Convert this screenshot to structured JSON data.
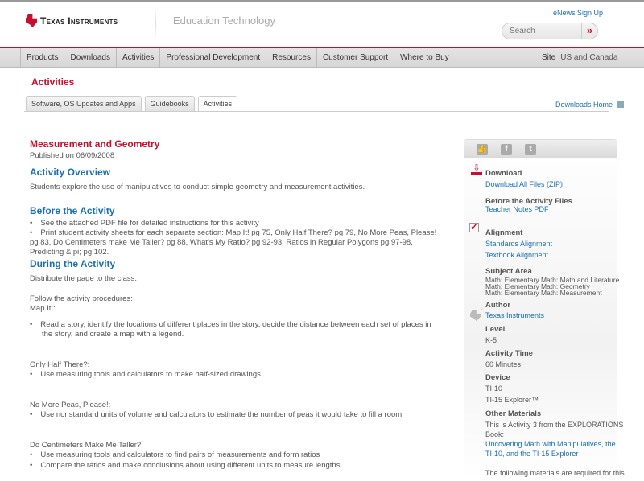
{
  "header": {
    "brand": "Texas Instruments",
    "section": "Education Technology",
    "enews": "eNews Sign Up",
    "search_placeholder": "Search",
    "search_go": "»"
  },
  "nav": {
    "items": [
      "Products",
      "Downloads",
      "Activities",
      "Professional Development",
      "Resources",
      "Customer Support",
      "Where to Buy"
    ],
    "site_label": "Site",
    "site_value": "US and Canada"
  },
  "page": {
    "title": "Activities",
    "tabs": [
      "Software, OS Updates and Apps",
      "Guidebooks",
      "Activities"
    ],
    "downloads_home": "Downloads Home"
  },
  "main": {
    "title": "Measurement and Geometry",
    "published": "Published on 06/09/2008",
    "overview_h": "Activity Overview",
    "overview": "Students explore the use of manipulatives to conduct simple geometry and measurement activities.",
    "before_h": "Before the Activity",
    "before_b1": "See the attached PDF file for detailed instructions for this activity",
    "before_b2a": "Print student activity sheets for each separate section: Map It! pg 75, Only Half There? pg 79, No More Peas, Please!",
    "before_b2b": "pg 83, Do Centimeters make Me Taller? pg 88, What's My Ratio? pg 92-93, Ratios in Regular Polygons pg 97-98,",
    "before_b2c": "Predicting & pi; pg 102.",
    "during_h": "During the Activity",
    "distribute": "Distribute the page to the class.",
    "follow": "Follow the activity procedures:",
    "mapit": "Map It!:",
    "mapit_b1a": "Read a story, identify the locations of different places in the story, decide the distance between each set of places in",
    "mapit_b1b": "the story, and create a map with a legend.",
    "half": "Only Half There?:",
    "half_b1": "Use measuring tools and calculators to make half-sized drawings",
    "peas": "No More Peas, Please!:",
    "peas_b1": "Use nonstandard units of volume and calculators to estimate the number of peas it would take to fill a room",
    "cm": "Do Centimeters Make Me Taller?:",
    "cm_b1": "Use measuring tools and calculators to find pairs of measurements and form ratios",
    "cm_b2": "Compare the ratios and make conclusions about using different units to measure lengths"
  },
  "sidebar": {
    "download_h": "Download",
    "download_all": "Download All Files (ZIP)",
    "before_files_h": "Before the Activity Files",
    "teacher_notes": "Teacher Notes PDF",
    "alignment_h": "Alignment",
    "standards": "Standards Alignment",
    "textbook": "Textbook Alignment",
    "subject_h": "Subject Area",
    "subjects": [
      "Math: Elementary Math: Math and Literature",
      "Math: Elementary Math: Geometry",
      "Math: Elementary Math: Measurement"
    ],
    "author_h": "Author",
    "author": "Texas Instruments",
    "level_h": "Level",
    "level": "K-5",
    "time_h": "Activity Time",
    "time": "60 Minutes",
    "device_h": "Device",
    "devices": [
      "TI-10",
      "TI-15 Explorer™"
    ],
    "materials_h": "Other Materials",
    "materials_a": "This is Activity 3 from the EXPLORATIONS",
    "materials_b": "Book:",
    "book_a": "Uncovering Math with Manipulatives, the",
    "book_b": "TI-10, and the TI-15 Explorer",
    "required": "The following materials are required for this"
  }
}
